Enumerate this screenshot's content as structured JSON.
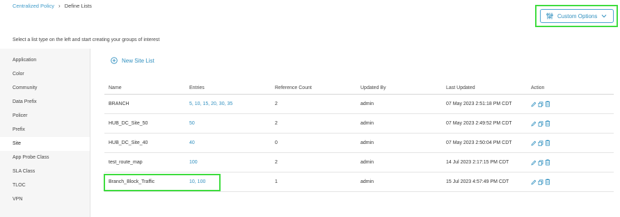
{
  "breadcrumb": {
    "parent": "Centralized Policy",
    "current": "Define Lists"
  },
  "custom_options": {
    "label": "Custom Options"
  },
  "instruction": "Select a list type on the left and start creating your groups of interest",
  "sidebar": {
    "items": [
      {
        "label": "Application"
      },
      {
        "label": "Color"
      },
      {
        "label": "Community"
      },
      {
        "label": "Data Prefix"
      },
      {
        "label": "Policer"
      },
      {
        "label": "Prefix"
      },
      {
        "label": "Site"
      },
      {
        "label": "App Probe Class"
      },
      {
        "label": "SLA Class"
      },
      {
        "label": "TLOC"
      },
      {
        "label": "VPN"
      }
    ],
    "active": "Site"
  },
  "new_list": {
    "label": "New Site List"
  },
  "table": {
    "headers": [
      "Name",
      "Entries",
      "Reference Count",
      "Updated By",
      "Last Updated",
      "Action"
    ],
    "rows": [
      {
        "name": "BRANCH",
        "entries": "5, 10, 15, 20, 30, 35",
        "ref": "2",
        "by": "admin",
        "updated": "07 May 2023 2:51:18 PM CDT"
      },
      {
        "name": "HUB_DC_Site_50",
        "entries": "50",
        "ref": "2",
        "by": "admin",
        "updated": "07 May 2023 2:49:52 PM CDT"
      },
      {
        "name": "HUB_DC_Site_40",
        "entries": "40",
        "ref": "0",
        "by": "admin",
        "updated": "07 May 2023 2:50:04 PM CDT"
      },
      {
        "name": "test_route_map",
        "entries": "100",
        "ref": "2",
        "by": "admin",
        "updated": "14 Jul 2023 2:17:15 PM CDT"
      },
      {
        "name": "Branch_Block_Traffic",
        "entries": "10, 100",
        "ref": "1",
        "by": "admin",
        "updated": "15 Jul 2023 4:57:49 PM CDT"
      }
    ]
  },
  "colors": {
    "accent": "#2f8fbf",
    "highlight": "#3ddc3d"
  }
}
